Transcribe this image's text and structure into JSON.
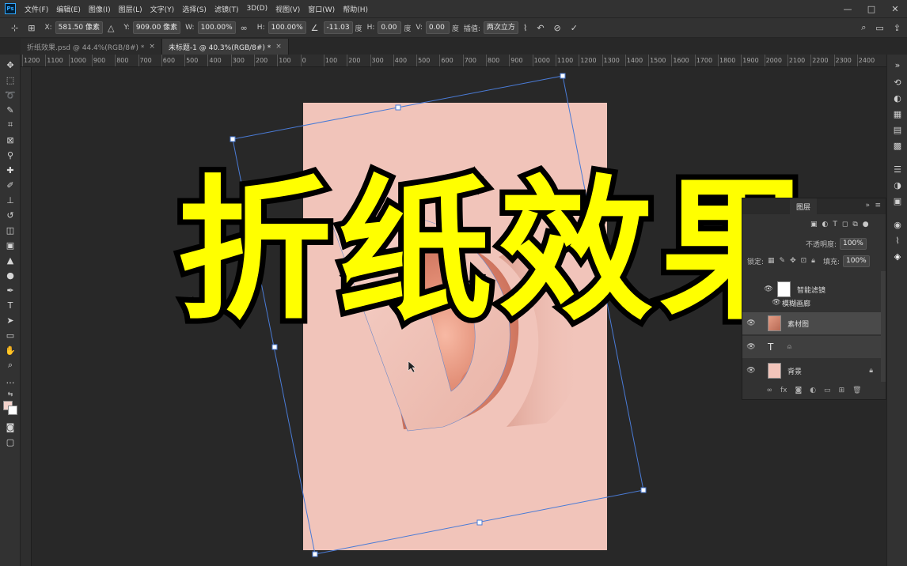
{
  "menubar": {
    "logo": "Ps",
    "items": [
      "文件(F)",
      "编辑(E)",
      "图像(I)",
      "图层(L)",
      "文字(Y)",
      "选择(S)",
      "滤镜(T)",
      "3D(D)",
      "视图(V)",
      "窗口(W)",
      "帮助(H)"
    ],
    "minimize": "—",
    "maximize": "□",
    "close": "✕"
  },
  "options": {
    "x_label": "X:",
    "x_value": "581.50 像素",
    "y_label": "Y:",
    "y_value": "909.00 像素",
    "w_label": "W:",
    "w_value": "100.00%",
    "h_label": "H:",
    "h_value": "100.00%",
    "angle_value": "-11.03",
    "angle_unit": "度",
    "hskew_label": "H:",
    "hskew_value": "0.00",
    "hskew_unit": "度",
    "vskew_label": "V:",
    "vskew_value": "0.00",
    "vskew_unit": "度",
    "interp_label": "插值:",
    "interp_value": "两次立方"
  },
  "tabs": [
    {
      "label": "折纸效果.psd @ 44.4%(RGB/8#) *",
      "active": false
    },
    {
      "label": "未标题-1 @ 40.3%(RGB/8#) *",
      "active": true
    }
  ],
  "tab_close": "×",
  "ruler_h": [
    "1200",
    "1100",
    "1000",
    "900",
    "800",
    "700",
    "600",
    "500",
    "400",
    "300",
    "200",
    "100",
    "0",
    "100",
    "200",
    "300",
    "400",
    "500",
    "600",
    "700",
    "800",
    "900",
    "1000",
    "1100",
    "1200",
    "1300",
    "1400",
    "1500",
    "1600",
    "1700",
    "1800",
    "1900",
    "2000",
    "2100",
    "2200",
    "2300",
    "2400"
  ],
  "overlay_title": "折纸效果",
  "layers": {
    "tab": "图层",
    "collapse": "»",
    "menu": "≡",
    "opacity_label": "不透明度:",
    "opacity_value": "100%",
    "lock_label": "锁定:",
    "fill_label": "填充:",
    "fill_value": "100%",
    "items": [
      {
        "name": "智能滤镜",
        "kind": "smart-filter"
      },
      {
        "name": "模糊画廊",
        "kind": "filter"
      },
      {
        "name": "素材图",
        "kind": "image"
      },
      {
        "name": "",
        "kind": "text"
      },
      {
        "name": "背景",
        "kind": "background"
      }
    ]
  },
  "colors": {
    "doc_background": "#f1c4ba",
    "title_fill": "#ffff00",
    "title_stroke": "#000000",
    "transform_box": "#4a7bd6"
  }
}
